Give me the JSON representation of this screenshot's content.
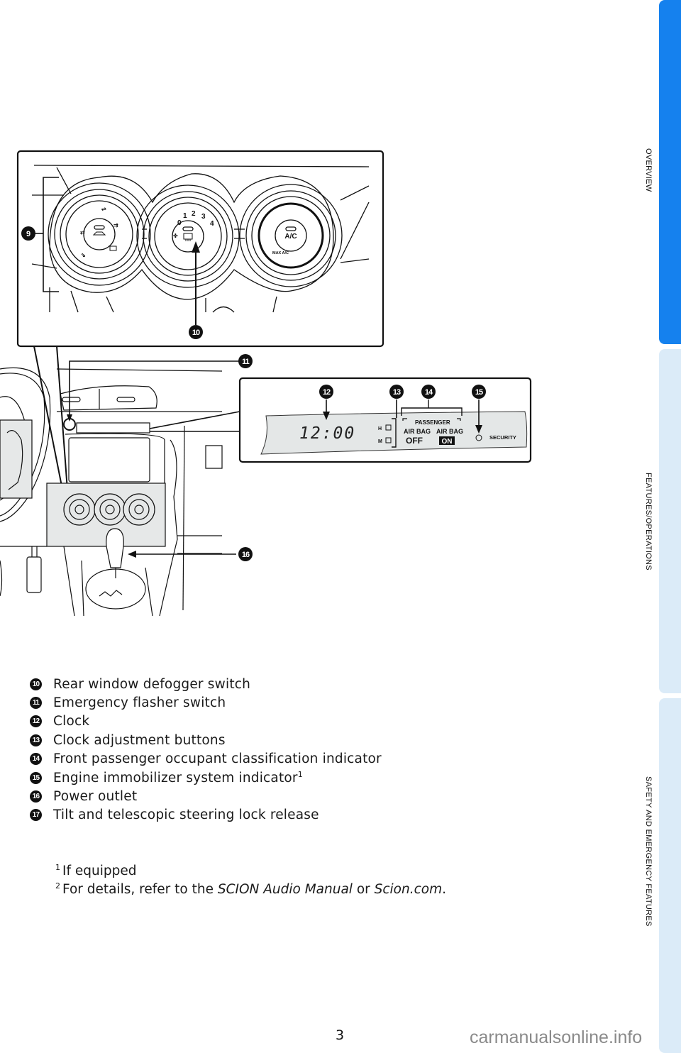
{
  "side_tabs": [
    {
      "label": "OVERVIEW",
      "active": true,
      "color": "#1581ee"
    },
    {
      "label": "FEATURES/OPERATIONS",
      "active": false,
      "color": "#dbebf8"
    },
    {
      "label": "SAFETY AND EMERGENCY FEATURES",
      "active": false,
      "color": "#dbebf8"
    }
  ],
  "diagram": {
    "callouts": {
      "c9": "9",
      "c10": "10",
      "c11": "11",
      "c12": "12",
      "c13": "13",
      "c14": "14",
      "c15": "15",
      "c16": "16"
    },
    "climate_panel": {
      "fan_dial_ticks": [
        "0",
        "1",
        "2",
        "3",
        "4"
      ],
      "ac_button": "A/C",
      "max_ac_label": "MAX A/C",
      "left_dial_icon": "airflow-mode-icon",
      "center_button_icon": "rear-defogger-icon",
      "right_dial_icon": "recirculation-icon"
    },
    "display_panel": {
      "clock": "12:00",
      "hour_button": "H",
      "minute_button": "M",
      "passenger_label": "PASSENGER",
      "airbag_off_label": "AIR BAG",
      "airbag_off_state": "OFF",
      "airbag_on_label": "AIR BAG",
      "airbag_on_state": "ON",
      "security_label": "SECURITY"
    }
  },
  "legend": [
    {
      "num": "10",
      "text": "Rear window defogger switch",
      "sup": ""
    },
    {
      "num": "11",
      "text": "Emergency flasher switch",
      "sup": ""
    },
    {
      "num": "12",
      "text": "Clock",
      "sup": ""
    },
    {
      "num": "13",
      "text": "Clock adjustment buttons",
      "sup": ""
    },
    {
      "num": "14",
      "text": "Front passenger occupant classification indicator",
      "sup": ""
    },
    {
      "num": "15",
      "text": "Engine immobilizer system indicator",
      "sup": "1"
    },
    {
      "num": "16",
      "text": "Power outlet",
      "sup": ""
    },
    {
      "num": "17",
      "text": "Tilt and telescopic steering lock release",
      "sup": ""
    }
  ],
  "footnotes": {
    "f1_mark": "1",
    "f1_text": "If equipped",
    "f2_mark": "2",
    "f2_prefix": "For details, refer to the ",
    "f2_italic1": "SCION Audio Manual",
    "f2_mid": " or ",
    "f2_italic2": "Scion.com",
    "f2_suffix": "."
  },
  "page_number": "3",
  "watermark": "carmanualsonline.info"
}
